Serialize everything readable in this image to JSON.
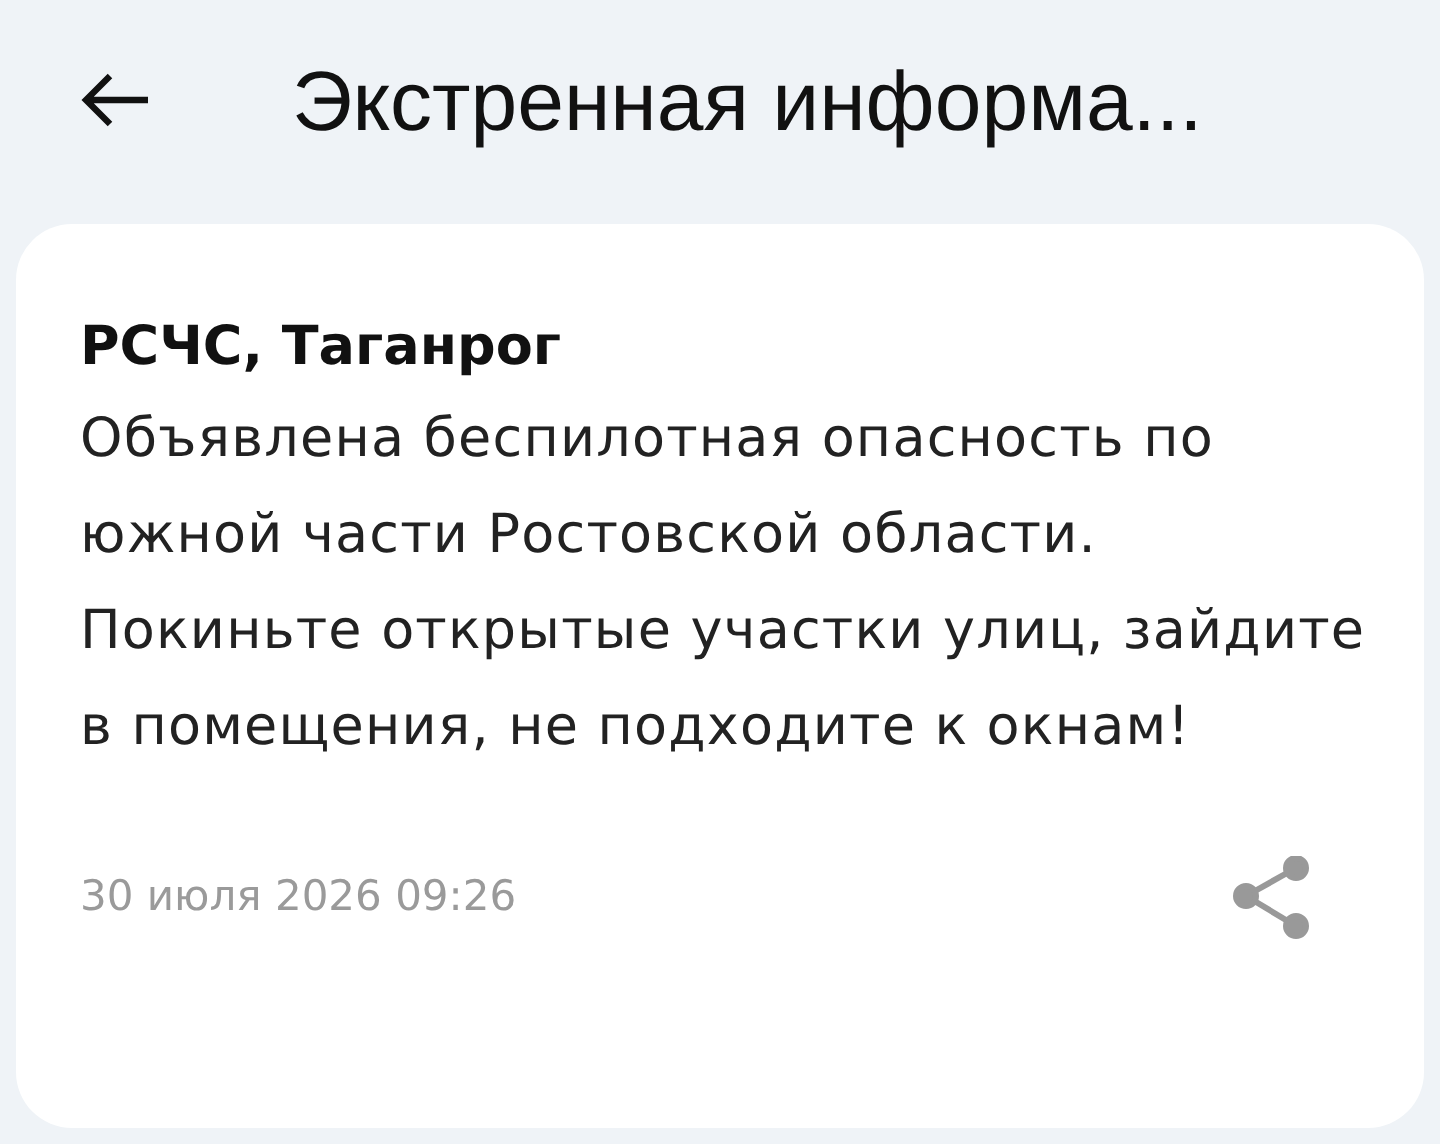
{
  "header": {
    "title": "Экстренная информа..."
  },
  "message": {
    "sender": "РСЧС, Таганрог",
    "text": "Объявлена беспилотная опасность по южной части Ростовской области. Покиньте открытые участки улиц, зайдите в помещения, не подходите к окнам!",
    "date": "30 июля 2026 09:26"
  }
}
